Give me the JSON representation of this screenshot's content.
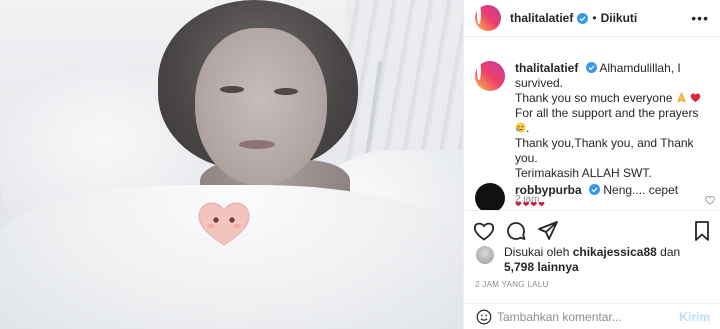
{
  "post": {
    "username": "thalitalatief",
    "follow_status": "Diikuti",
    "more_icon": "more-horizontal-icon",
    "verified_icon": "verified-badge-icon"
  },
  "caption": {
    "username": "thalitalatief",
    "text_line1": "Alhamdulillah, I survived.",
    "text_line2": "Thank you so much everyone",
    "text_line3": "For all the support and the prayers",
    "text_line4": "Thank you,Thank you, and Thank you.",
    "text_line5": "Terimakasih ALLAH SWT.",
    "time": "2 jam"
  },
  "comment": {
    "username": "robbypurba",
    "text": "Neng.... cepet",
    "hearts": "❤❤❤❤"
  },
  "likes": {
    "prefix": "Disukai oleh",
    "user": "chikajessica88",
    "joiner": "dan",
    "count": "5,798 lainnya"
  },
  "timestamp": "2 JAM YANG LALU",
  "add_comment": {
    "placeholder": "Tambahkan komentar...",
    "post_label": "Kirim"
  },
  "colors": {
    "accent": "#0095f6",
    "post_disabled": "#b2dffc",
    "secondary_text": "#8e8e8e"
  }
}
